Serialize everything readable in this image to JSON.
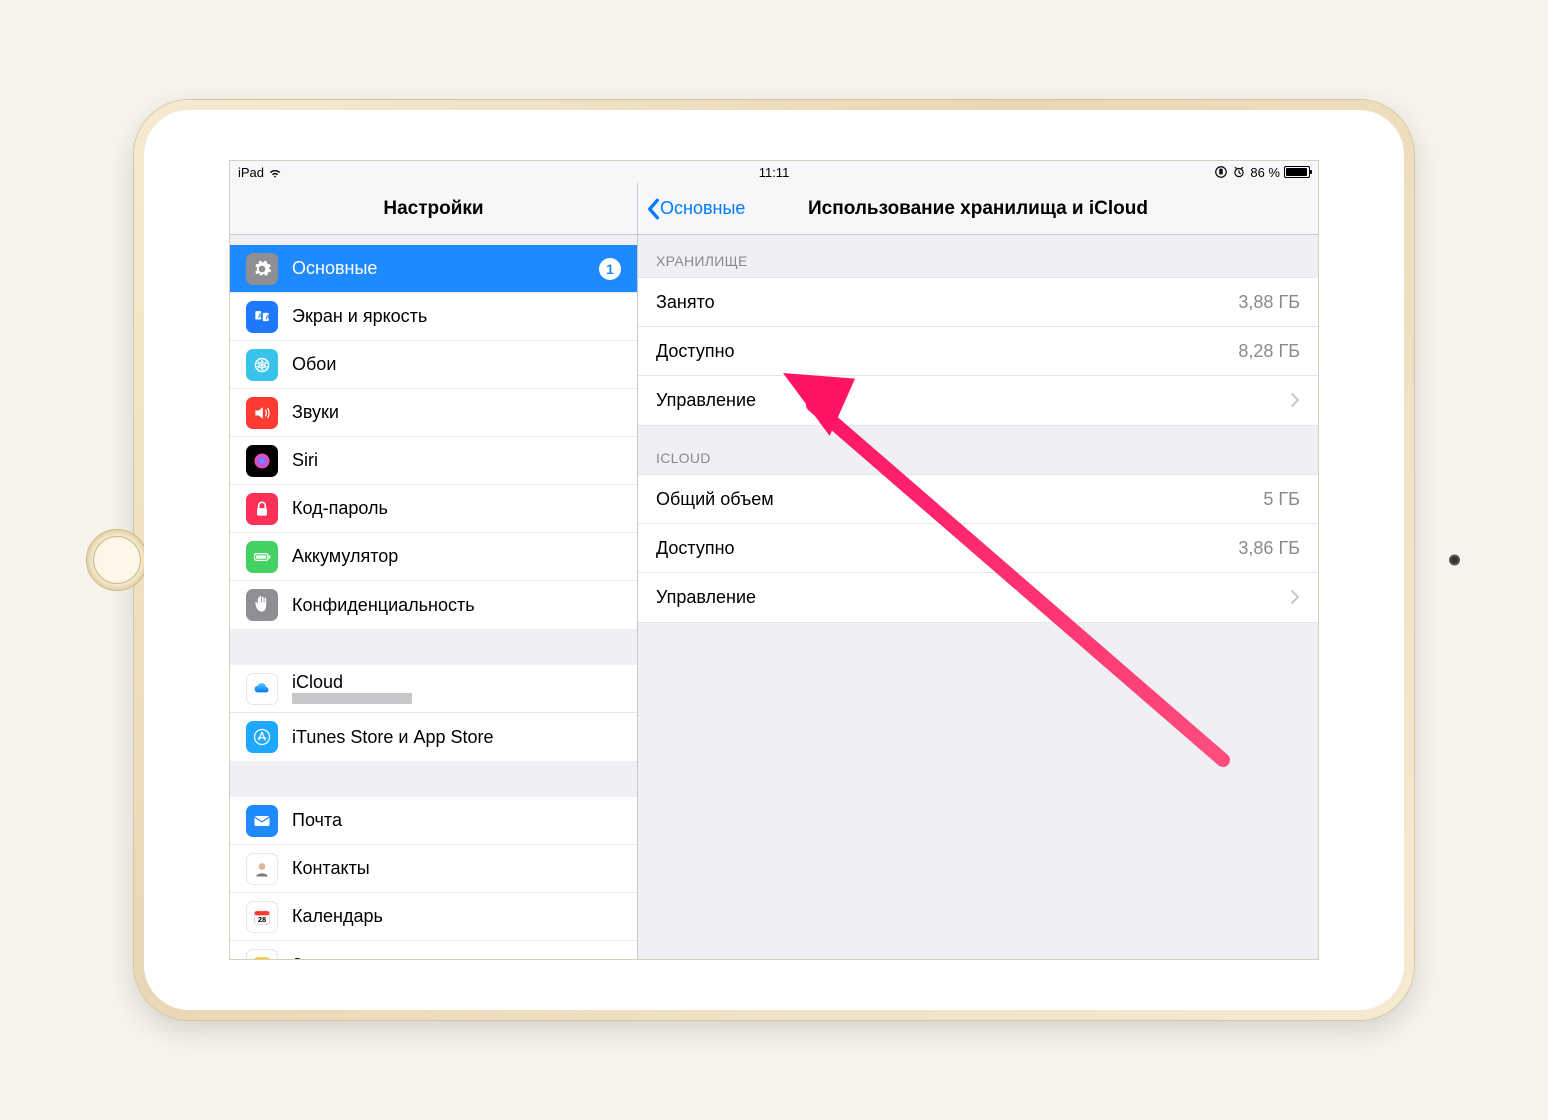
{
  "status": {
    "device": "iPad",
    "time": "11:11",
    "battery_text": "86 %",
    "battery_pct": 86
  },
  "headers": {
    "left_title": "Настройки",
    "back_label": "Основные",
    "right_title": "Использование хранилища и iCloud"
  },
  "sidebar": {
    "group1": [
      {
        "label": "Основные",
        "badge": "1",
        "selected": true,
        "icon": "gear",
        "color": "#8e8e93"
      },
      {
        "label": "Экран и яркость",
        "icon": "brightness",
        "color": "#1f79ff"
      },
      {
        "label": "Обои",
        "icon": "wallpaper",
        "color": "#37c3ea"
      },
      {
        "label": "Звуки",
        "icon": "sound",
        "color": "#ff3a30"
      },
      {
        "label": "Siri",
        "icon": "siri",
        "color": "#000"
      },
      {
        "label": "Код-пароль",
        "icon": "lock",
        "color": "#ff3159"
      },
      {
        "label": "Аккумулятор",
        "icon": "battery",
        "color": "#44d163"
      },
      {
        "label": "Конфиденциальность",
        "icon": "hand",
        "color": "#8e8e93"
      }
    ],
    "group2": [
      {
        "label": "iCloud",
        "sub_redacted": true,
        "icon": "cloud",
        "color": "#fff"
      },
      {
        "label": "iTunes Store и App Store",
        "icon": "appstore",
        "color": "#1fa8ff"
      }
    ],
    "group3": [
      {
        "label": "Почта",
        "icon": "mail",
        "color": "#1f8afe"
      },
      {
        "label": "Контакты",
        "icon": "contacts",
        "color": "#b9b9be"
      },
      {
        "label": "Календарь",
        "icon": "calendar",
        "color": "#fff"
      },
      {
        "label": "Заметки",
        "icon": "notes",
        "color": "#fff"
      }
    ]
  },
  "detail": {
    "sections": [
      {
        "title": "ХРАНИЛИЩЕ",
        "rows": [
          {
            "label": "Занято",
            "value": "3,88 ГБ"
          },
          {
            "label": "Доступно",
            "value": "8,28 ГБ"
          },
          {
            "label": "Управление",
            "chevron": true,
            "interactable": true
          }
        ]
      },
      {
        "title": "ICLOUD",
        "rows": [
          {
            "label": "Общий объем",
            "value": "5 ГБ"
          },
          {
            "label": "Доступно",
            "value": "3,86 ГБ"
          },
          {
            "label": "Управление",
            "chevron": true,
            "interactable": true
          }
        ]
      }
    ]
  }
}
